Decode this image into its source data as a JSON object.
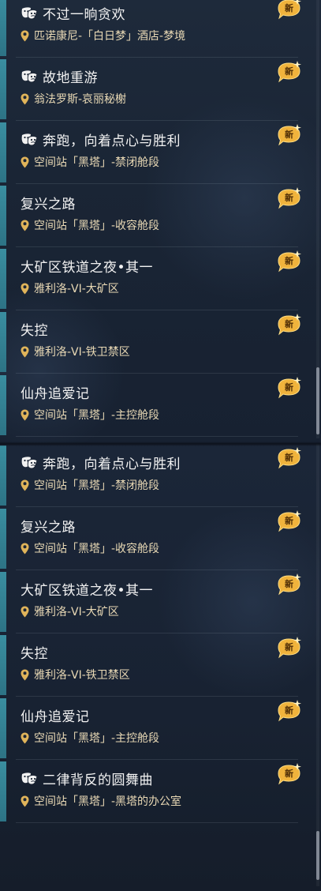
{
  "top_list": [
    {
      "title": "不过一晌贪欢",
      "location": "匹诺康尼-「白日梦」酒店-梦境",
      "has_mask_icon": true,
      "badge": "新"
    },
    {
      "title": "故地重游",
      "location": "翁法罗斯-哀丽秘榭",
      "has_mask_icon": true,
      "badge": "新"
    },
    {
      "title": "奔跑，向着点心与胜利",
      "location": "空间站「黑塔」-禁闭舱段",
      "has_mask_icon": true,
      "badge": "新"
    },
    {
      "title": "复兴之路",
      "location": "空间站「黑塔」-收容舱段",
      "has_mask_icon": false,
      "badge": "新"
    },
    {
      "title": "大矿区铁道之夜•其一",
      "location": "雅利洛-VI-大矿区",
      "has_mask_icon": false,
      "badge": "新"
    },
    {
      "title": "失控",
      "location": "雅利洛-VI-铁卫禁区",
      "has_mask_icon": false,
      "badge": "新"
    },
    {
      "title": "仙舟追爱记",
      "location": "空间站「黑塔」-主控舱段",
      "has_mask_icon": false,
      "badge": "新"
    }
  ],
  "bottom_list": [
    {
      "title": "奔跑，向着点心与胜利",
      "location": "空间站「黑塔」-禁闭舱段",
      "has_mask_icon": true,
      "badge": "新"
    },
    {
      "title": "复兴之路",
      "location": "空间站「黑塔」-收容舱段",
      "has_mask_icon": false,
      "badge": "新"
    },
    {
      "title": "大矿区铁道之夜•其一",
      "location": "雅利洛-VI-大矿区",
      "has_mask_icon": false,
      "badge": "新"
    },
    {
      "title": "失控",
      "location": "雅利洛-VI-铁卫禁区",
      "has_mask_icon": false,
      "badge": "新"
    },
    {
      "title": "仙舟追爱记",
      "location": "空间站「黑塔」-主控舱段",
      "has_mask_icon": false,
      "badge": "新"
    },
    {
      "title": "二律背反的圆舞曲",
      "location": "空间站「黑塔」-黑塔的办公室",
      "has_mask_icon": true,
      "badge": "新"
    }
  ],
  "colors": {
    "accent": "#3a8ea0",
    "title_text": "#f2f2f2",
    "location_text": "#e9d9b5",
    "badge_gold": "#f0b33c"
  },
  "icons": {
    "mask": "theater-mask-icon",
    "location": "map-pin-icon",
    "badge": "new-badge-icon"
  }
}
